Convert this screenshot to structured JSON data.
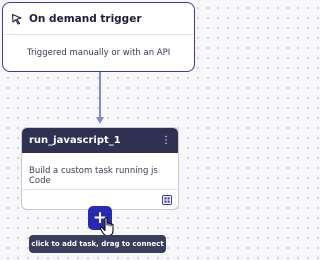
{
  "trigger": {
    "title": "On demand trigger",
    "description": "Triggered manually or with an API",
    "icon": "cursor-pointer-icon"
  },
  "task": {
    "title": "run_javascript_1",
    "description": "Build a custom task running js Code",
    "menu_icon": "more-vertical-icon",
    "footer_icon": "grid-icon"
  },
  "add_task": {
    "icon": "plus-icon"
  },
  "tooltip": {
    "text": "click to add task, drag to connect"
  },
  "colors": {
    "accent": "#2a2ab0",
    "trigger_border": "#3a3aa8",
    "task_header": "#2e3152",
    "connector": "#7a8ed0",
    "tooltip_bg": "#3b3d5c"
  }
}
